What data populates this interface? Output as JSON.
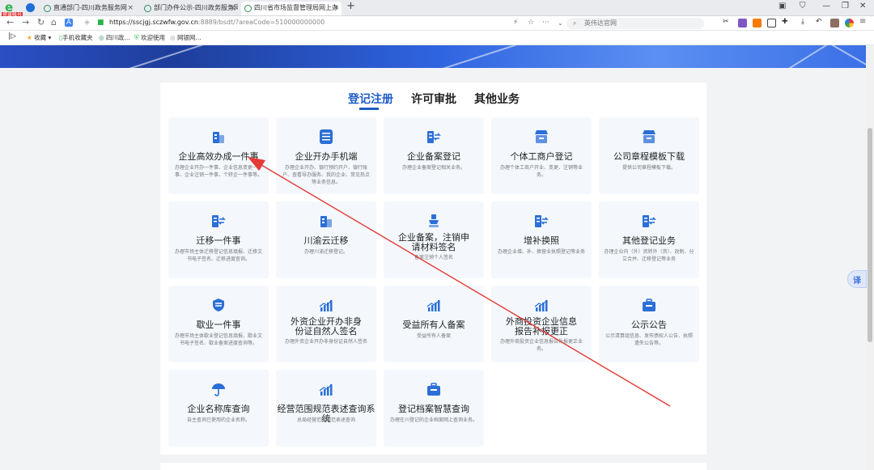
{
  "browser": {
    "logo_label": "登录帐号",
    "tabs": [
      {
        "title": "直通部门-四川政务服务网"
      },
      {
        "title": "部门办件公示-四川政务服务网"
      },
      {
        "title": "四川省市场监督管理局网上办"
      }
    ],
    "url_host": "https://sscjgj.sczwfw.gov.cn",
    "url_rest": ":8889/bsdt/?areaCode=510000000000",
    "search_placeholder": "英伟达官网",
    "bookmarks": [
      "收藏",
      "手机收藏夹",
      "四川政...",
      "欢迎使用",
      "网银网..."
    ]
  },
  "page": {
    "tabs": [
      "登记注册",
      "许可审批",
      "其他业务"
    ],
    "active_tab": "登记注册",
    "cards": [
      {
        "title": "企业高效办成一件事",
        "desc": "办理企业开办一件事、企业信息变更一件事、企业注销一件事、个转企一件事等。",
        "icon": "building-icon",
        "color": "#2c6fd6"
      },
      {
        "title": "企业开办手机端",
        "desc": "办理企业开办、银行预约开户、银行账户、查看导办服务、我的企业、常见热点等业务信息。",
        "icon": "mobile-icon",
        "color": "#2c6fd6"
      },
      {
        "title": "企业备案登记",
        "desc": "办理企业备案登记相关业务。",
        "icon": "transfer-icon",
        "color": "#2c6fd6"
      },
      {
        "title": "个体工商户登记",
        "desc": "办理个体工商户开业、变更、注销等业务。",
        "icon": "shop-icon",
        "color": "#2c6fd6"
      },
      {
        "title": "公司章程模板下载",
        "desc": "提供公司章程模板下载。",
        "icon": "shop-icon",
        "color": "#2c6fd6"
      },
      {
        "title": "迁移一件事",
        "desc": "办理市场主体迁移登记信息填报、迁移文书电子签名、迁移进度查询。",
        "icon": "transfer-icon",
        "color": "#2c6fd6"
      },
      {
        "title": "川渝云迁移",
        "desc": "办理川渝迁移登记。",
        "icon": "building-icon",
        "color": "#2c6fd6"
      },
      {
        "title": "企业备案，注销申请材料签名",
        "desc": "备案注销个人签名",
        "icon": "stamp-icon",
        "color": "#2c6fd6"
      },
      {
        "title": "增补换照",
        "desc": "办理企业增、补、换营业执照登记等业务",
        "icon": "transfer-icon",
        "color": "#2c6fd6"
      },
      {
        "title": "其他登记业务",
        "desc": "办理企业内（外）资转外（资）、改制、分立合并、迁移登记等业务",
        "icon": "transfer-icon",
        "color": "#2c6fd6"
      },
      {
        "title": "歇业一件事",
        "desc": "办理市场主体歇业登记信息填报、歇业文书电子签名、歇业备案进度查询等。",
        "icon": "shield-icon",
        "color": "#2c6fd6"
      },
      {
        "title": "外资企业开办非身份证自然人签名",
        "desc": "办理外资企业开办非身份证自然人签名",
        "icon": "chart-icon",
        "color": "#2c6fd6"
      },
      {
        "title": "受益所有人备案",
        "desc": "受益所有人备案",
        "icon": "chart-icon",
        "color": "#2c6fd6"
      },
      {
        "title": "外商投资企业信息报告补报更正",
        "desc": "办理外商投资企业信息报告补报更正业务。",
        "icon": "chart-icon",
        "color": "#2c6fd6"
      },
      {
        "title": "公示公告",
        "desc": "公示清算组信息、发布债权人公告、执照遗失公告等。",
        "icon": "briefcase-icon",
        "color": "#2c6fd6"
      },
      {
        "title": "企业名称库查询",
        "desc": "自主查询已使用的企业名称。",
        "icon": "umbrella-icon",
        "color": "#2c6fd6"
      },
      {
        "title": "经营范围规范表述查询系统",
        "desc": "总局经营范围规范表述查询",
        "icon": "chart-icon",
        "color": "#2c6fd6"
      },
      {
        "title": "登记档案智慧查询",
        "desc": "办理在川登记的企业档案网上查询业务。",
        "icon": "briefcase-icon",
        "color": "#2c6fd6"
      }
    ]
  },
  "float_button": {
    "label": "译"
  },
  "annotation": {
    "color": "#e53935"
  }
}
